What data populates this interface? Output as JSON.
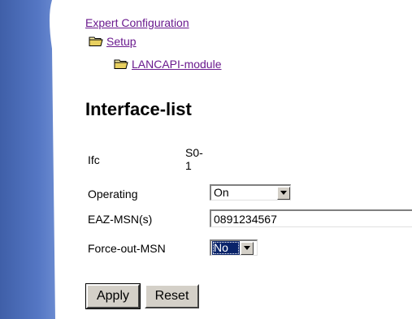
{
  "breadcrumb": {
    "root": "Expert Configuration",
    "level1": "Setup",
    "level2": "LANCAPI-module"
  },
  "page_title": "Interface-list",
  "fields": {
    "ifc": {
      "label": "Ifc",
      "value": "S0-1"
    },
    "operating": {
      "label": "Operating",
      "value": "On"
    },
    "eaz_msn": {
      "label": "EAZ-MSN(s)",
      "value": "0891234567"
    },
    "force_out_msn": {
      "label": "Force-out-MSN",
      "value": "No"
    }
  },
  "buttons": {
    "apply": "Apply",
    "reset": "Reset"
  },
  "icons": {
    "folder": "folder-icon",
    "dropdown": "chevron-down-icon"
  },
  "colors": {
    "link": "#6a1a8e",
    "sidebar_blue": "#4a6bb8",
    "selection": "#0a246a",
    "button_face": "#d4d0c8"
  }
}
